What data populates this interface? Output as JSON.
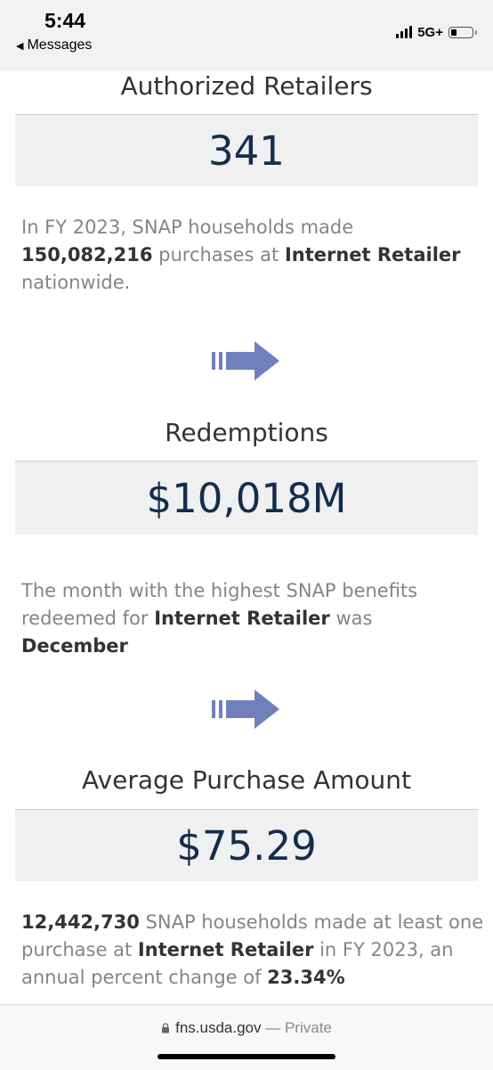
{
  "status_bar": {
    "time": "5:44",
    "back_label": "Messages",
    "network": "5G+",
    "battery_level_fraction": 0.3
  },
  "sections": [
    {
      "title": "Authorized Retailers",
      "value": "341"
    },
    {
      "title": "Redemptions",
      "value": "$10,018M"
    },
    {
      "title": "Average Purchase Amount",
      "value": "$75.29"
    }
  ],
  "paragraphs": {
    "p1": {
      "t1": "In FY 2023, SNAP households made ",
      "purchases": "150,082,216",
      "t2": " purchases at ",
      "retailer": "Internet Retailer",
      "t3": " nationwide."
    },
    "p2": {
      "t1": "The month with the highest SNAP benefits redeemed for ",
      "retailer": "Internet Retailer",
      "t2": " was ",
      "month": "December"
    },
    "p3": {
      "households": "12,442,730",
      "t1": " SNAP households made at least one purchase at ",
      "retailer": "Internet Retailer",
      "t2": " in FY 2023, an annual percent change of ",
      "percent": "23.34%"
    }
  },
  "icons": {
    "arrow": "right-arrow-icon",
    "lock": "lock-icon"
  },
  "colors": {
    "value_text": "#142d4c",
    "arrow": "#6f80bd",
    "body_text": "#858585",
    "bold_text": "#333333"
  },
  "url_bar": {
    "domain": "fns.usda.gov",
    "separator": " — ",
    "mode": "Private"
  }
}
